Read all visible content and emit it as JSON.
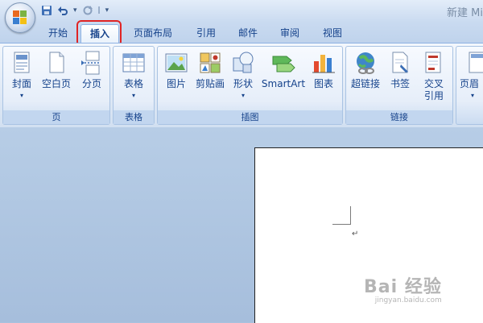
{
  "window": {
    "title": "新建 Mi"
  },
  "colors": {
    "accent_red": "#e02424",
    "ribbon_text": "#15428b"
  },
  "tabs": [
    {
      "label": "开始"
    },
    {
      "label": "插入"
    },
    {
      "label": "页面布局"
    },
    {
      "label": "引用"
    },
    {
      "label": "邮件"
    },
    {
      "label": "审阅"
    },
    {
      "label": "视图"
    }
  ],
  "active_tab": "插入",
  "qat": {
    "icons": [
      "save-icon",
      "undo-icon",
      "redo-icon",
      "customize-icon"
    ]
  },
  "ribbon": {
    "groups": [
      {
        "label": "页",
        "buttons": [
          {
            "label": "封面",
            "icon": "cover-page-icon"
          },
          {
            "label": "空白页",
            "icon": "blank-page-icon"
          },
          {
            "label": "分页",
            "icon": "page-break-icon"
          }
        ]
      },
      {
        "label": "表格",
        "buttons": [
          {
            "label": "表格",
            "icon": "table-icon"
          }
        ]
      },
      {
        "label": "插图",
        "buttons": [
          {
            "label": "图片",
            "icon": "picture-icon"
          },
          {
            "label": "剪贴画",
            "icon": "clipart-icon"
          },
          {
            "label": "形状",
            "icon": "shapes-icon"
          },
          {
            "label": "SmartArt",
            "icon": "smartart-icon"
          },
          {
            "label": "图表",
            "icon": "chart-icon"
          }
        ]
      },
      {
        "label": "链接",
        "buttons": [
          {
            "label": "超链接",
            "icon": "hyperlink-icon"
          },
          {
            "label": "书签",
            "icon": "bookmark-icon"
          },
          {
            "label": "交叉",
            "label2": "引用",
            "icon": "cross-reference-icon"
          }
        ]
      },
      {
        "label": "",
        "buttons": [
          {
            "label": "页眉",
            "icon": "header-icon"
          }
        ]
      }
    ]
  },
  "document": {
    "paragraph_mark": "↵"
  },
  "watermark": {
    "main": "Bai 经验",
    "sub": "jingyan.baidu.com"
  }
}
